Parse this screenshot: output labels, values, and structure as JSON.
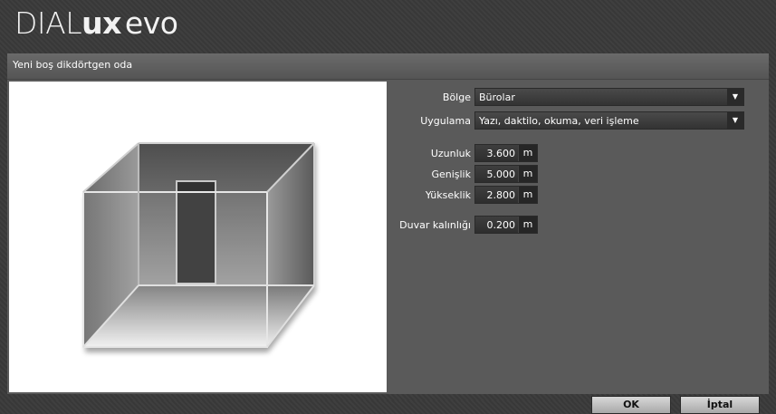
{
  "app": {
    "logo_dial": "DIAL",
    "logo_ux": "ux",
    "logo_evo": "evo"
  },
  "dialog": {
    "title": "Yeni boş dikdörtgen oda"
  },
  "form": {
    "bolge_label": "Bölge",
    "bolge_value": "Bürolar",
    "uygulama_label": "Uygulama",
    "uygulama_value": "Yazı, daktilo, okuma, veri işleme",
    "uzunluk_label": "Uzunluk",
    "uzunluk_value": "3.600",
    "genislik_label": "Genişlik",
    "genislik_value": "5.000",
    "yukseklik_label": "Yükseklik",
    "yukseklik_value": "2.800",
    "duvar_label": "Duvar kalınlığı",
    "duvar_value": "0.200",
    "unit": "m"
  },
  "buttons": {
    "ok": "OK",
    "cancel": "İptal"
  },
  "icons": {
    "dropdown": "chevron-down-icon"
  }
}
